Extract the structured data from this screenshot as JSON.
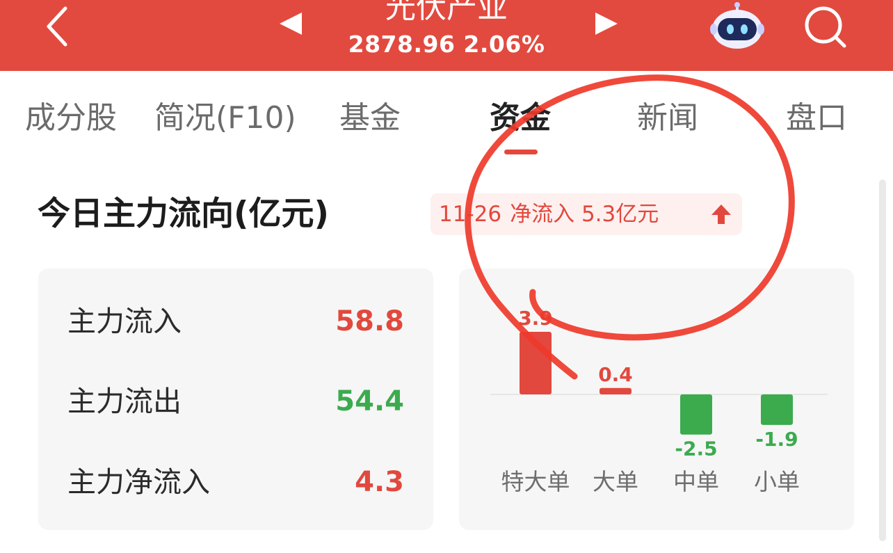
{
  "header": {
    "title": "光伏产业",
    "subtitle": "2878.96 2.06%",
    "background_color": "#e24a3f",
    "icons": [
      "back-arrow-icon",
      "prev-triangle-icon",
      "next-triangle-icon",
      "robot-assistant-icon",
      "search-icon"
    ]
  },
  "tabs": [
    {
      "label": "成分股"
    },
    {
      "label": "简况(F10)"
    },
    {
      "label": "基金"
    },
    {
      "label": "资金",
      "active": true
    },
    {
      "label": "新闻"
    },
    {
      "label": "盘口"
    }
  ],
  "section": {
    "title": "今日主力流向(亿元)",
    "badge_date": "11-26",
    "badge_text": "净流入 5.3亿元",
    "badge_icon": "up-arrow-icon"
  },
  "flows": [
    {
      "label": "主力流入",
      "value": "58.8",
      "color": "#e2483d"
    },
    {
      "label": "主力流出",
      "value": "54.4",
      "color": "#3bab4e"
    },
    {
      "label": "主力净流入",
      "value": "4.3",
      "color": "#e2483d"
    }
  ],
  "chart_data": {
    "type": "bar",
    "categories": [
      "特大单",
      "大单",
      "中单",
      "小单"
    ],
    "values": [
      3.9,
      0.4,
      -2.5,
      -1.9
    ],
    "value_labels": [
      "3.9",
      "0.4",
      "-2.5",
      "-1.9"
    ],
    "positive_color": "#e2483d",
    "negative_color": "#3bab4e"
  },
  "annotation": {
    "type": "hand-drawn circle",
    "color": "#ee3a2a"
  }
}
